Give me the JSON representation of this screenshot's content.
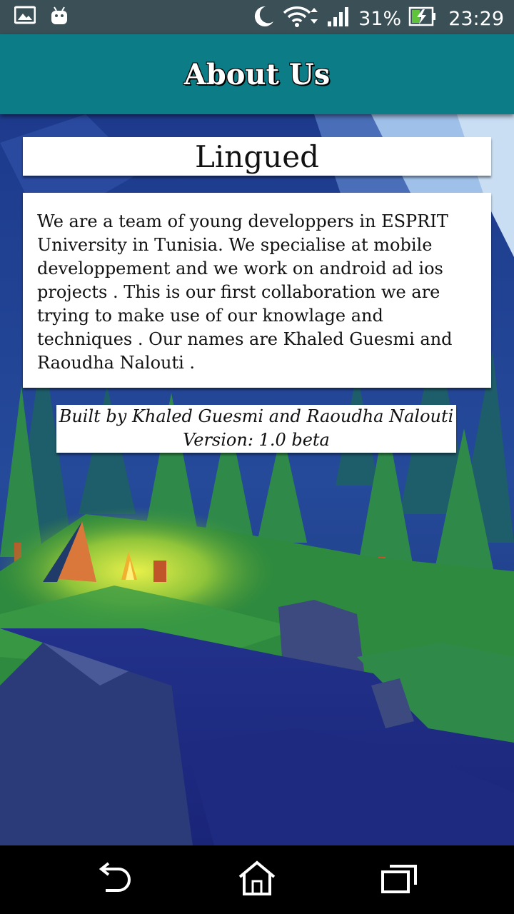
{
  "status_bar": {
    "icons_left": [
      "image-icon",
      "android-icon"
    ],
    "icons_right": [
      "moon-icon",
      "wifi-icon",
      "signal-icon",
      "battery-charging-icon"
    ],
    "battery": "31%",
    "time": "23:29"
  },
  "app_bar": {
    "title": "About Us"
  },
  "app": {
    "name": "Lingued",
    "description": "We are a team of young developpers in ESPRIT University in Tunisia. We specialise at mobile developpement and we work on android ad ios projects . This is our first collaboration we are trying to make use of our knowlage and techniques . Our names are Khaled Guesmi and Raoudha Nalouti .",
    "credits": "Built by Khaled Guesmi and Raoudha Nalouti",
    "version": "Version: 1.0 beta"
  },
  "nav_bar": {
    "icons": [
      "back-icon",
      "home-icon",
      "recents-icon"
    ]
  },
  "colors": {
    "app_bar": "#0c7d86",
    "status_bar": "#3b4f57",
    "card": "#ffffff"
  }
}
